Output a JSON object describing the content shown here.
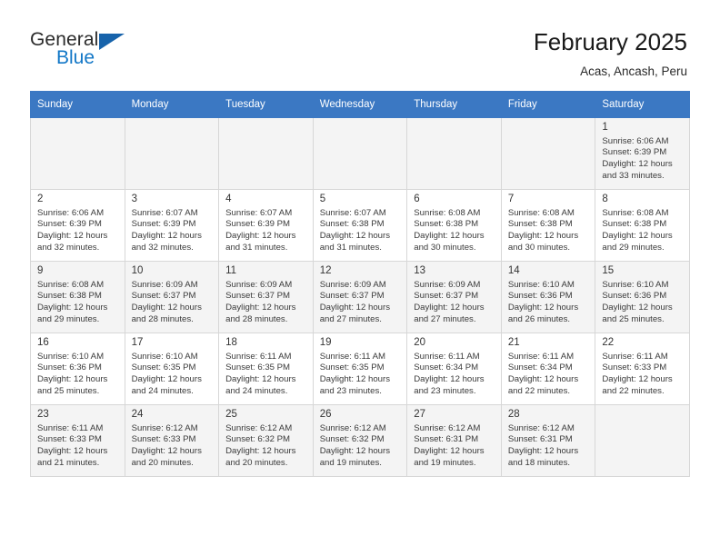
{
  "brand": {
    "word1": "General",
    "word2": "Blue",
    "flag_icon": "triangle-flag-icon",
    "accent_color": "#1277c7",
    "flag_color": "#1763ab"
  },
  "header": {
    "title": "February 2025",
    "subtitle": "Acas, Ancash, Peru"
  },
  "calendar": {
    "header_color": "#3b78c3",
    "weekday_headers": [
      "Sunday",
      "Monday",
      "Tuesday",
      "Wednesday",
      "Thursday",
      "Friday",
      "Saturday"
    ],
    "labels": {
      "sunrise": "Sunrise:",
      "sunset": "Sunset:",
      "daylight": "Daylight:"
    },
    "weeks": [
      [
        {
          "day": "",
          "empty": true
        },
        {
          "day": "",
          "empty": true
        },
        {
          "day": "",
          "empty": true
        },
        {
          "day": "",
          "empty": true
        },
        {
          "day": "",
          "empty": true
        },
        {
          "day": "",
          "empty": true
        },
        {
          "day": "1",
          "sunrise": "Sunrise: 6:06 AM",
          "sunset": "Sunset: 6:39 PM",
          "daylight1": "Daylight: 12 hours",
          "daylight2": "and 33 minutes."
        }
      ],
      [
        {
          "day": "2",
          "sunrise": "Sunrise: 6:06 AM",
          "sunset": "Sunset: 6:39 PM",
          "daylight1": "Daylight: 12 hours",
          "daylight2": "and 32 minutes."
        },
        {
          "day": "3",
          "sunrise": "Sunrise: 6:07 AM",
          "sunset": "Sunset: 6:39 PM",
          "daylight1": "Daylight: 12 hours",
          "daylight2": "and 32 minutes."
        },
        {
          "day": "4",
          "sunrise": "Sunrise: 6:07 AM",
          "sunset": "Sunset: 6:39 PM",
          "daylight1": "Daylight: 12 hours",
          "daylight2": "and 31 minutes."
        },
        {
          "day": "5",
          "sunrise": "Sunrise: 6:07 AM",
          "sunset": "Sunset: 6:38 PM",
          "daylight1": "Daylight: 12 hours",
          "daylight2": "and 31 minutes."
        },
        {
          "day": "6",
          "sunrise": "Sunrise: 6:08 AM",
          "sunset": "Sunset: 6:38 PM",
          "daylight1": "Daylight: 12 hours",
          "daylight2": "and 30 minutes."
        },
        {
          "day": "7",
          "sunrise": "Sunrise: 6:08 AM",
          "sunset": "Sunset: 6:38 PM",
          "daylight1": "Daylight: 12 hours",
          "daylight2": "and 30 minutes."
        },
        {
          "day": "8",
          "sunrise": "Sunrise: 6:08 AM",
          "sunset": "Sunset: 6:38 PM",
          "daylight1": "Daylight: 12 hours",
          "daylight2": "and 29 minutes."
        }
      ],
      [
        {
          "day": "9",
          "sunrise": "Sunrise: 6:08 AM",
          "sunset": "Sunset: 6:38 PM",
          "daylight1": "Daylight: 12 hours",
          "daylight2": "and 29 minutes."
        },
        {
          "day": "10",
          "sunrise": "Sunrise: 6:09 AM",
          "sunset": "Sunset: 6:37 PM",
          "daylight1": "Daylight: 12 hours",
          "daylight2": "and 28 minutes."
        },
        {
          "day": "11",
          "sunrise": "Sunrise: 6:09 AM",
          "sunset": "Sunset: 6:37 PM",
          "daylight1": "Daylight: 12 hours",
          "daylight2": "and 28 minutes."
        },
        {
          "day": "12",
          "sunrise": "Sunrise: 6:09 AM",
          "sunset": "Sunset: 6:37 PM",
          "daylight1": "Daylight: 12 hours",
          "daylight2": "and 27 minutes."
        },
        {
          "day": "13",
          "sunrise": "Sunrise: 6:09 AM",
          "sunset": "Sunset: 6:37 PM",
          "daylight1": "Daylight: 12 hours",
          "daylight2": "and 27 minutes."
        },
        {
          "day": "14",
          "sunrise": "Sunrise: 6:10 AM",
          "sunset": "Sunset: 6:36 PM",
          "daylight1": "Daylight: 12 hours",
          "daylight2": "and 26 minutes."
        },
        {
          "day": "15",
          "sunrise": "Sunrise: 6:10 AM",
          "sunset": "Sunset: 6:36 PM",
          "daylight1": "Daylight: 12 hours",
          "daylight2": "and 25 minutes."
        }
      ],
      [
        {
          "day": "16",
          "sunrise": "Sunrise: 6:10 AM",
          "sunset": "Sunset: 6:36 PM",
          "daylight1": "Daylight: 12 hours",
          "daylight2": "and 25 minutes."
        },
        {
          "day": "17",
          "sunrise": "Sunrise: 6:10 AM",
          "sunset": "Sunset: 6:35 PM",
          "daylight1": "Daylight: 12 hours",
          "daylight2": "and 24 minutes."
        },
        {
          "day": "18",
          "sunrise": "Sunrise: 6:11 AM",
          "sunset": "Sunset: 6:35 PM",
          "daylight1": "Daylight: 12 hours",
          "daylight2": "and 24 minutes."
        },
        {
          "day": "19",
          "sunrise": "Sunrise: 6:11 AM",
          "sunset": "Sunset: 6:35 PM",
          "daylight1": "Daylight: 12 hours",
          "daylight2": "and 23 minutes."
        },
        {
          "day": "20",
          "sunrise": "Sunrise: 6:11 AM",
          "sunset": "Sunset: 6:34 PM",
          "daylight1": "Daylight: 12 hours",
          "daylight2": "and 23 minutes."
        },
        {
          "day": "21",
          "sunrise": "Sunrise: 6:11 AM",
          "sunset": "Sunset: 6:34 PM",
          "daylight1": "Daylight: 12 hours",
          "daylight2": "and 22 minutes."
        },
        {
          "day": "22",
          "sunrise": "Sunrise: 6:11 AM",
          "sunset": "Sunset: 6:33 PM",
          "daylight1": "Daylight: 12 hours",
          "daylight2": "and 22 minutes."
        }
      ],
      [
        {
          "day": "23",
          "sunrise": "Sunrise: 6:11 AM",
          "sunset": "Sunset: 6:33 PM",
          "daylight1": "Daylight: 12 hours",
          "daylight2": "and 21 minutes."
        },
        {
          "day": "24",
          "sunrise": "Sunrise: 6:12 AM",
          "sunset": "Sunset: 6:33 PM",
          "daylight1": "Daylight: 12 hours",
          "daylight2": "and 20 minutes."
        },
        {
          "day": "25",
          "sunrise": "Sunrise: 6:12 AM",
          "sunset": "Sunset: 6:32 PM",
          "daylight1": "Daylight: 12 hours",
          "daylight2": "and 20 minutes."
        },
        {
          "day": "26",
          "sunrise": "Sunrise: 6:12 AM",
          "sunset": "Sunset: 6:32 PM",
          "daylight1": "Daylight: 12 hours",
          "daylight2": "and 19 minutes."
        },
        {
          "day": "27",
          "sunrise": "Sunrise: 6:12 AM",
          "sunset": "Sunset: 6:31 PM",
          "daylight1": "Daylight: 12 hours",
          "daylight2": "and 19 minutes."
        },
        {
          "day": "28",
          "sunrise": "Sunrise: 6:12 AM",
          "sunset": "Sunset: 6:31 PM",
          "daylight1": "Daylight: 12 hours",
          "daylight2": "and 18 minutes."
        },
        {
          "day": "",
          "empty": true
        }
      ]
    ]
  }
}
